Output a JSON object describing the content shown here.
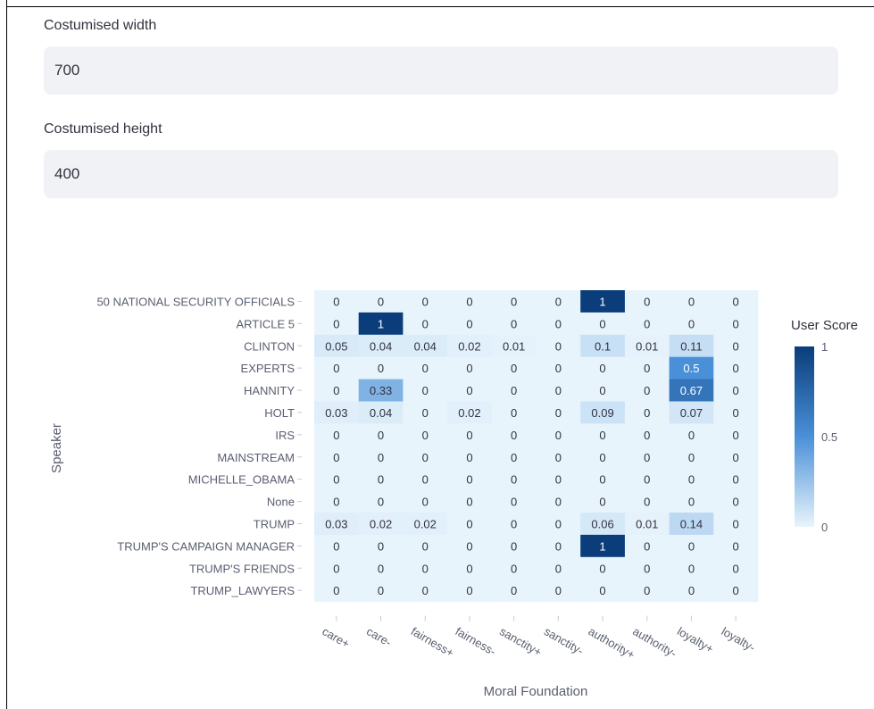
{
  "form": {
    "width_label": "Costumised width",
    "width_value": "700",
    "height_label": "Costumised height",
    "height_value": "400"
  },
  "chart_data": {
    "type": "heatmap",
    "xlabel": "Moral Foundation",
    "ylabel": "Speaker",
    "colorbar_title": "User Score",
    "colorbar_range": [
      0,
      1
    ],
    "colorbar_ticks": [
      "1",
      "0.5",
      "0"
    ],
    "colorscale": [
      "#e8f4fc",
      "#0a3d7a"
    ],
    "x": [
      "care+",
      "care-",
      "fairness+",
      "fairness-",
      "sanctity+",
      "sanctity-",
      "authority+",
      "authority-",
      "loyalty+",
      "loyalty-"
    ],
    "y": [
      "50 NATIONAL SECURITY OFFICIALS",
      "ARTICLE 5",
      "CLINTON",
      "EXPERTS",
      "HANNITY",
      "HOLT",
      "IRS",
      "MAINSTREAM",
      "MICHELLE_OBAMA",
      "None",
      "TRUMP",
      "TRUMP'S CAMPAIGN MANAGER",
      "TRUMP'S FRIENDS",
      "TRUMP_LAWYERS"
    ],
    "z": [
      [
        0,
        0,
        0,
        0,
        0,
        0,
        1,
        0,
        0,
        0
      ],
      [
        0,
        1,
        0,
        0,
        0,
        0,
        0,
        0,
        0,
        0
      ],
      [
        0.05,
        0.04,
        0.04,
        0.02,
        0.01,
        0,
        0.1,
        0.01,
        0.11,
        0
      ],
      [
        0,
        0,
        0,
        0,
        0,
        0,
        0,
        0,
        0.5,
        0
      ],
      [
        0,
        0.33,
        0,
        0,
        0,
        0,
        0,
        0,
        0.67,
        0
      ],
      [
        0.03,
        0.04,
        0,
        0.02,
        0,
        0,
        0.09,
        0,
        0.07,
        0
      ],
      [
        0,
        0,
        0,
        0,
        0,
        0,
        0,
        0,
        0,
        0
      ],
      [
        0,
        0,
        0,
        0,
        0,
        0,
        0,
        0,
        0,
        0
      ],
      [
        0,
        0,
        0,
        0,
        0,
        0,
        0,
        0,
        0,
        0
      ],
      [
        0,
        0,
        0,
        0,
        0,
        0,
        0,
        0,
        0,
        0
      ],
      [
        0.03,
        0.02,
        0.02,
        0,
        0,
        0,
        0.06,
        0.01,
        0.14,
        0
      ],
      [
        0,
        0,
        0,
        0,
        0,
        0,
        1,
        0,
        0,
        0
      ],
      [
        0,
        0,
        0,
        0,
        0,
        0,
        0,
        0,
        0,
        0
      ],
      [
        0,
        0,
        0,
        0,
        0,
        0,
        0,
        0,
        0,
        0
      ]
    ]
  }
}
